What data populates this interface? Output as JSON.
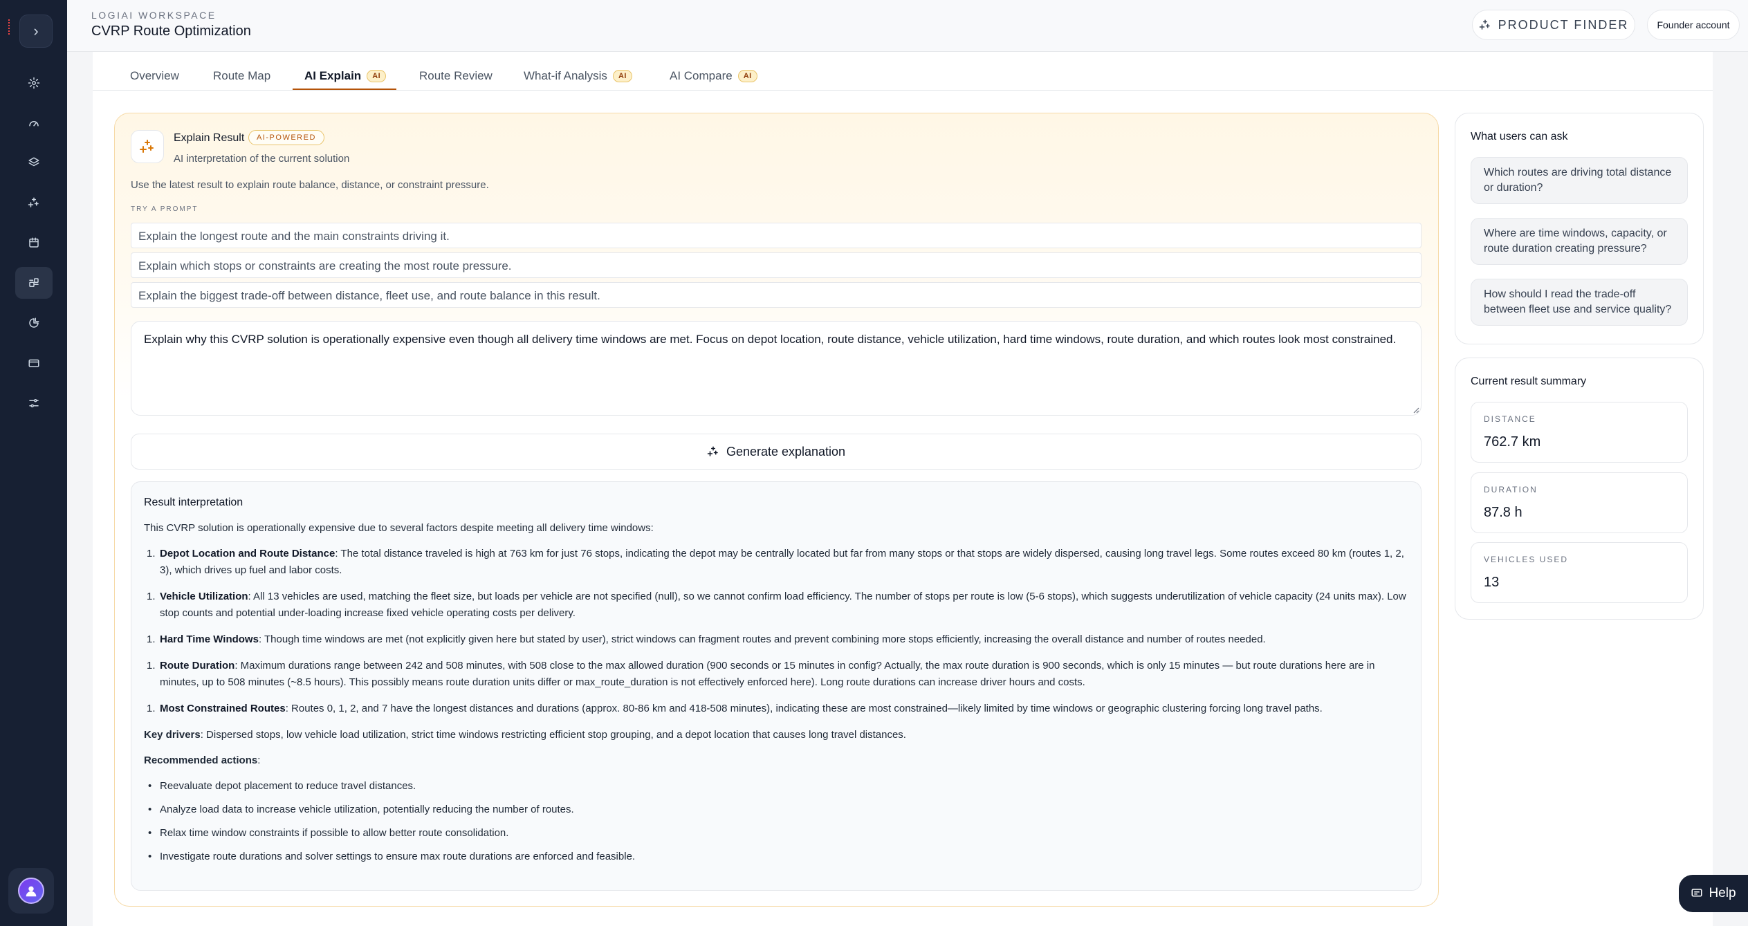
{
  "app": {
    "workspace_label": "LOGIAI WORKSPACE",
    "page_title": "CVRP Route Optimization",
    "product_finder_label": "PRODUCT FINDER",
    "account_label": "Founder account"
  },
  "sidebar": {
    "toggle_icon": "chevron-right-icon",
    "items": [
      {
        "icon": "settings-icon"
      },
      {
        "icon": "gauge-icon"
      },
      {
        "icon": "layers-icon"
      },
      {
        "icon": "sparkles-icon"
      },
      {
        "icon": "calendar-icon"
      },
      {
        "icon": "apps-icon",
        "active": true
      },
      {
        "icon": "chart-icon"
      },
      {
        "icon": "card-icon"
      },
      {
        "icon": "sliders-icon"
      }
    ],
    "avatar_icon": "user-avatar-icon"
  },
  "tabs": [
    {
      "label": "Overview",
      "ai": false
    },
    {
      "label": "Route Map",
      "ai": false
    },
    {
      "label": "AI Explain",
      "ai": true,
      "active": true
    },
    {
      "label": "Route Review",
      "ai": false
    },
    {
      "label": "What-if Analysis",
      "ai": true
    },
    {
      "label": "AI Compare",
      "ai": true
    }
  ],
  "ai_badge_label": "AI",
  "explain": {
    "title": "Explain Result",
    "badge": "AI-POWERED",
    "subtitle": "AI interpretation of the current solution",
    "hint": "Use the latest result to explain route balance, distance, or constraint pressure.",
    "try_label": "TRY A PROMPT",
    "prompts": [
      "Explain the longest route and the main constraints driving it.",
      "Explain which stops or constraints are creating the most route pressure.",
      "Explain the biggest trade-off between distance, fleet use, and route balance in this result."
    ],
    "question": "Explain why this CVRP solution is operationally expensive even though all delivery time windows are met. Focus on depot location, route distance, vehicle utilization, hard time windows, route duration, and which routes look most constrained.",
    "generate_label": "Generate explanation"
  },
  "result": {
    "title": "Result interpretation",
    "intro": "This CVRP solution is operationally expensive due to several factors despite meeting all delivery time windows:",
    "items": [
      {
        "num": "1.",
        "head": "Depot Location and Route Distance",
        "text": ": The total distance traveled is high at 763 km for just 76 stops, indicating the depot may be centrally located but far from many stops or that stops are widely dispersed, causing long travel legs. Some routes exceed 80 km (routes 1, 2, 3), which drives up fuel and labor costs."
      },
      {
        "num": "1.",
        "head": "Vehicle Utilization",
        "text": ": All 13 vehicles are used, matching the fleet size, but loads per vehicle are not specified (null), so we cannot confirm load efficiency. The number of stops per route is low (5-6 stops), which suggests underutilization of vehicle capacity (24 units max). Low stop counts and potential under-loading increase fixed vehicle operating costs per delivery."
      },
      {
        "num": "1.",
        "head": "Hard Time Windows",
        "text": ": Though time windows are met (not explicitly given here but stated by user), strict windows can fragment routes and prevent combining more stops efficiently, increasing the overall distance and number of routes needed."
      },
      {
        "num": "1.",
        "head": "Route Duration",
        "text": ": Maximum durations range between 242 and 508 minutes, with 508 close to the max allowed duration (900 seconds or 15 minutes in config? Actually, the max route duration is 900 seconds, which is only 15 minutes — but route durations here are in minutes, up to 508 minutes (~8.5 hours). This possibly means route duration units differ or max_route_duration is not effectively enforced here). Long route durations can increase driver hours and costs."
      },
      {
        "num": "1.",
        "head": "Most Constrained Routes",
        "text": ": Routes 0, 1, 2, and 7 have the longest distances and durations (approx. 80-86 km and 418-508 minutes), indicating these are most constrained—likely limited by time windows or geographic clustering forcing long travel paths."
      }
    ],
    "key_drivers_head": "Key drivers",
    "key_drivers_text": ": Dispersed stops, low vehicle load utilization, strict time windows restricting efficient stop grouping, and a depot location that causes long travel distances.",
    "actions_head": "Recommended actions",
    "actions_colon": ":",
    "actions": [
      "Reevaluate depot placement to reduce travel distances.",
      "Analyze load data to increase vehicle utilization, potentially reducing the number of routes.",
      "Relax time window constraints if possible to allow better route consolidation.",
      "Investigate route durations and solver settings to ensure max route durations are enforced and feasible."
    ]
  },
  "ask": {
    "title": "What users can ask",
    "items": [
      "Which routes are driving total distance or duration?",
      "Where are time windows, capacity, or route duration creating pressure?",
      "How should I read the trade-off between fleet use and service quality?"
    ]
  },
  "summary": {
    "title": "Current result summary",
    "metrics": [
      {
        "label": "DISTANCE",
        "value": "762.7 km"
      },
      {
        "label": "DURATION",
        "value": "87.8 h"
      },
      {
        "label": "VEHICLES USED",
        "value": "13"
      }
    ]
  },
  "help": {
    "label": "Help",
    "icon": "chat-icon"
  },
  "colors": {
    "sidebar": "#172033",
    "accent": "#b45309",
    "ai_badge_bg": "#fdf0c9"
  }
}
